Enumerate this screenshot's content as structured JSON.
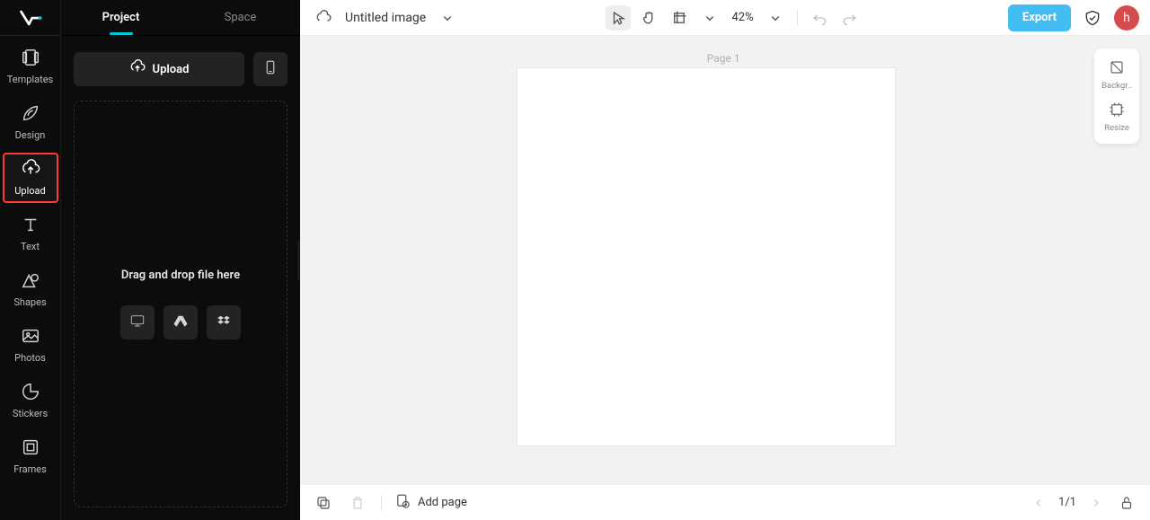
{
  "rail": {
    "items": [
      {
        "label": "Templates"
      },
      {
        "label": "Design"
      },
      {
        "label": "Upload"
      },
      {
        "label": "Text"
      },
      {
        "label": "Shapes"
      },
      {
        "label": "Photos"
      },
      {
        "label": "Stickers"
      },
      {
        "label": "Frames"
      }
    ]
  },
  "panel": {
    "tabs": [
      {
        "label": "Project"
      },
      {
        "label": "Space"
      }
    ],
    "upload_label": "Upload",
    "drop_text": "Drag and drop file here"
  },
  "topbar": {
    "title": "Untitled image",
    "zoom": "42%",
    "export_label": "Export",
    "avatar_initial": "h"
  },
  "canvas": {
    "page_label": "Page 1"
  },
  "side_tools": {
    "background_label": "Backgr..",
    "resize_label": "Resize"
  },
  "bottombar": {
    "add_page_label": "Add page",
    "page_indicator": "1/1"
  }
}
